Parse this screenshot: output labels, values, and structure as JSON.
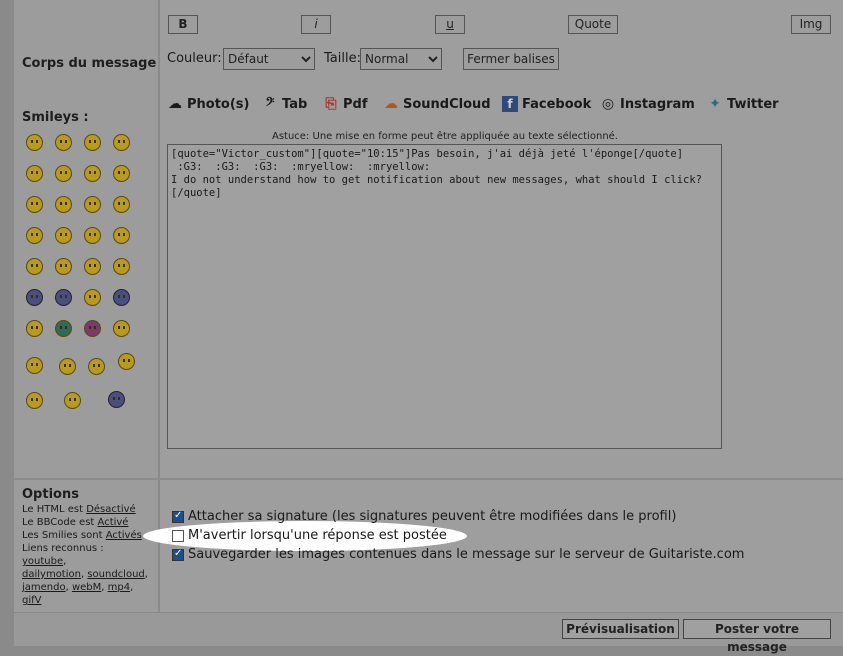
{
  "toolbar": {
    "bold": "B",
    "italic": "i",
    "underline": "u",
    "quote": "Quote",
    "img": "Img"
  },
  "left": {
    "body_label": "Corps du message",
    "smileys_label": "Smileys :"
  },
  "format": {
    "color_label": "Couleur:",
    "color_value": "Défaut",
    "size_label": "Taille:",
    "size_value": "Normal",
    "close_tags": "Fermer balises"
  },
  "media": {
    "photos": "Photo(s)",
    "tab": "Tab",
    "pdf": "Pdf",
    "soundcloud": "SoundCloud",
    "facebook": "Facebook",
    "instagram": "Instagram",
    "twitter": "Twitter"
  },
  "tip": "Astuce: Une mise en forme peut être appliquée au texte sélectionné.",
  "message": "[quote=\"Victor_custom\"][quote=\"10:15\"]Pas besoin, j'ai déjà jeté l'éponge[/quote]\n :G3:  :G3:  :G3:  :mryellow:  :mryellow:\nI do not understand how to get notification about new messages, what should I click?[/quote]",
  "options": {
    "title": "Options",
    "html_prefix": "Le HTML est",
    "html_value": "Désactivé",
    "bbcode_prefix": "Le BBCode est",
    "bbcode_value": "Activé",
    "smilies_prefix": "Les Smilies sont",
    "smilies_value": "Activés",
    "links_label": "Liens reconnus :",
    "link_youtube": "youtube",
    "link_dailymotion": "dailymotion",
    "link_soundcloud": "soundcloud",
    "link_jamendo": "jamendo",
    "link_webm": "webM",
    "link_mp4": "mp4",
    "link_gifv": "gifV",
    "attach_signature": "Attacher sa signature (les signatures peuvent être modifiées dans le profil)",
    "notify": "M'avertir lorsqu'une réponse est postée",
    "save_images": "Sauvegarder les images contenues dans le message sur le serveur de Guitariste.com"
  },
  "checkboxes": {
    "attach_signature": true,
    "notify": false,
    "save_images": true
  },
  "buttons": {
    "preview": "Prévisualisation",
    "post": "Poster votre message"
  }
}
